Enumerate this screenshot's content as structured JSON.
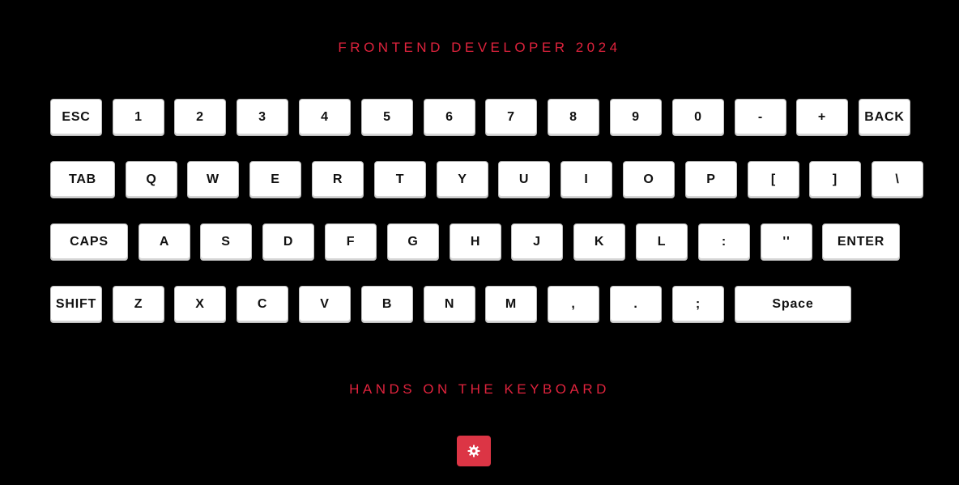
{
  "header": {
    "title": "FRONTEND DEVELOPER 2024"
  },
  "footer": {
    "subtitle": "HANDS ON THE KEYBOARD"
  },
  "settings_button": {
    "icon": "gear-icon",
    "color": "#dc3545"
  },
  "accent_color": "#e0233d",
  "keyboard": {
    "rows": [
      [
        "ESC",
        "1",
        "2",
        "3",
        "4",
        "5",
        "6",
        "7",
        "8",
        "9",
        "0",
        "-",
        "+",
        "BACK"
      ],
      [
        "TAB",
        "Q",
        "W",
        "E",
        "R",
        "T",
        "Y",
        "U",
        "I",
        "O",
        "P",
        "[",
        "]",
        "\\"
      ],
      [
        "CAPS",
        "A",
        "S",
        "D",
        "F",
        "G",
        "H",
        "J",
        "K",
        "L",
        ":",
        "''",
        "ENTER"
      ],
      [
        "SHIFT",
        "Z",
        "X",
        "C",
        "V",
        "B",
        "N",
        "M",
        ",",
        ".",
        ";",
        "Space"
      ]
    ]
  }
}
